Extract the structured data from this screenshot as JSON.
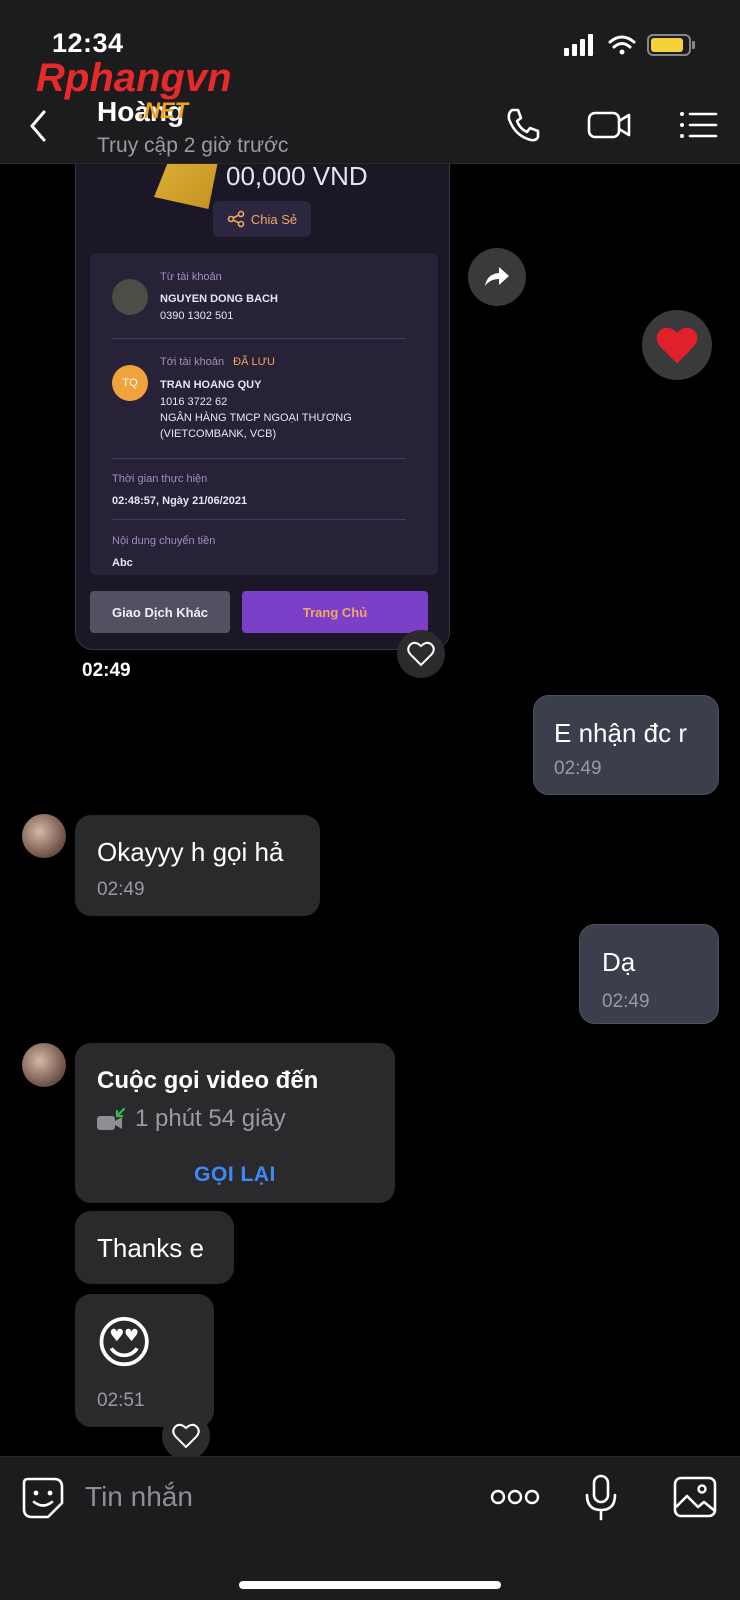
{
  "status_bar": {
    "time": "12:34"
  },
  "header": {
    "contact_name": "Hoàng",
    "contact_status": "Truy cập 2 giờ trước",
    "watermark_brand": "Rphangvn",
    "watermark_suffix": ".NET"
  },
  "receipt": {
    "amount": "00,000 VND",
    "share_label": "Chia Sẻ",
    "from_label": "Từ tài khoản",
    "from_name": "NGUYEN DONG BACH",
    "from_account": "0390 1302 501",
    "to_label": "Tới tài khoản",
    "to_saved": "ĐÃ LƯU",
    "to_initials": "TQ",
    "to_name": "TRAN HOANG QUY",
    "to_account": "1016 3722 62",
    "to_bank_line1": "NGÂN HÀNG TMCP NGOẠI THƯƠNG",
    "to_bank_line2": "(VIETCOMBANK, VCB)",
    "time_label": "Thời gian thực hiện",
    "time_value": "02:48:57, Ngày 21/06/2021",
    "content_label": "Nội dung chuyển tiền",
    "content_value": "Abc",
    "btn_other": "Giao Dịch Khác",
    "btn_home": "Trang Chủ"
  },
  "messages": {
    "image_time": "02:49",
    "out1_text": "E nhận đc r",
    "out1_time": "02:49",
    "in1_text": "Okayyy h gọi hả",
    "in1_time": "02:49",
    "out2_text": "Dạ",
    "out2_time": "02:49",
    "call_title": "Cuộc gọi video đến",
    "call_duration": "1 phút 54 giây",
    "call_action": "GỌI LẠI",
    "in2_text": "Thanks e",
    "in3_emoji": "😍",
    "in3_time": "02:51"
  },
  "composer": {
    "placeholder": "Tin nhắn"
  },
  "colors": {
    "accent_blue": "#3d8af7",
    "call_missed_green": "#2fbf4f",
    "heart_red": "#e0202a"
  }
}
